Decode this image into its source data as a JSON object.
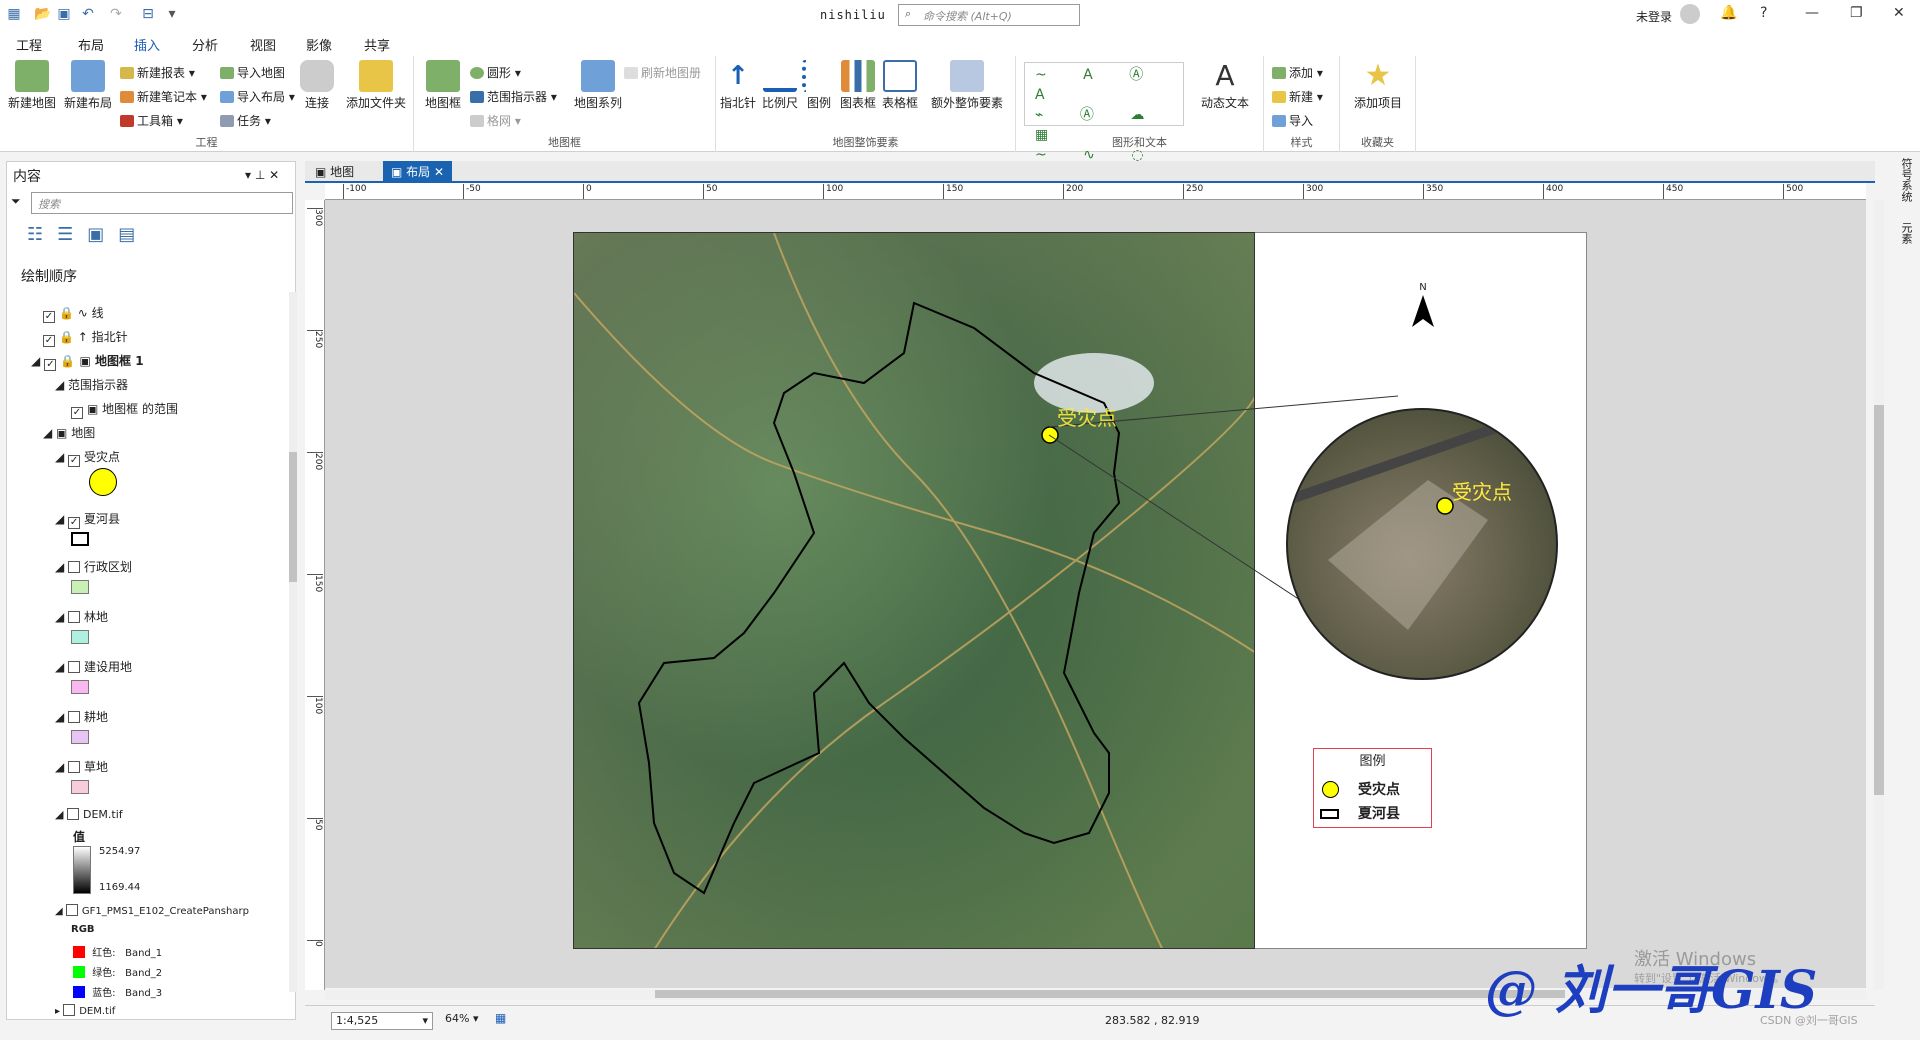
{
  "window": {
    "title": "nishiliu",
    "command_placeholder": "命令搜索 (Alt+Q)",
    "user": "未登录"
  },
  "menu": {
    "tabs": [
      "工程",
      "布局",
      "插入",
      "分析",
      "视图",
      "影像",
      "共享"
    ],
    "active": 2
  },
  "ribbon": {
    "project": {
      "label": "工程",
      "new_map": "新建地图",
      "new_layout": "新建布局",
      "new_report": "新建报表",
      "new_notebook": "新建笔记本",
      "toolbox": "工具箱",
      "import_map": "导入地图",
      "import_layout": "导入布局",
      "task": "任务",
      "connect": "连接",
      "add_folder": "添加文件夹"
    },
    "mapframe": {
      "label": "地图框",
      "map_frame": "地图框",
      "shape": "圆形",
      "extent_indicator": "范围指示器",
      "grid": "格网",
      "map_series": "地图系列",
      "refresh": "刷新地图册"
    },
    "surround": {
      "label": "地图整饰要素",
      "north": "指北针",
      "scale": "比例尺",
      "legend": "图例",
      "chart_frame": "图表框",
      "table_frame": "表格框",
      "extra": "额外整饰要素"
    },
    "graphics": {
      "label": "图形和文本",
      "dynamic_text": "动态文本"
    },
    "styles": {
      "label": "样式",
      "add": "添加",
      "new": "新建",
      "import": "导入"
    },
    "favorites": {
      "label": "收藏夹",
      "add_item": "添加项目"
    }
  },
  "contents": {
    "title": "内容",
    "search_placeholder": "搜索",
    "drawing_order": "绘制顺序",
    "items": [
      {
        "label": "线",
        "checked": true
      },
      {
        "label": "指北针",
        "checked": true
      },
      {
        "label": "地图框 1",
        "checked": true
      },
      {
        "label": "范围指示器"
      },
      {
        "label": "地图框 的范围",
        "checked": true
      },
      {
        "label": "地图"
      },
      {
        "label": "受灾点",
        "checked": true
      },
      {
        "label": "夏河县",
        "checked": true
      },
      {
        "label": "行政区划",
        "checked": false
      },
      {
        "label": "林地",
        "checked": false
      },
      {
        "label": "建设用地",
        "checked": false
      },
      {
        "label": "耕地",
        "checked": false
      },
      {
        "label": "草地",
        "checked": false
      },
      {
        "label": "DEM.tif",
        "checked": false
      },
      {
        "label": "GF1_PMS1_E102_CreatePansharp",
        "checked": false
      },
      {
        "label": "DEM.tif",
        "checked": false
      }
    ],
    "dem_value_label": "值",
    "dem_max": "5254.97",
    "dem_min": "1169.44",
    "rgb_label": "RGB",
    "rgb": [
      {
        "label": "红色:",
        "band": "Band_1"
      },
      {
        "label": "绿色:",
        "band": "Band_2"
      },
      {
        "label": "蓝色:",
        "band": "Band_3"
      }
    ]
  },
  "doc_tabs": [
    "地图",
    "布局"
  ],
  "ruler_top": [
    "-100",
    "-50",
    "0",
    "50",
    "100",
    "150",
    "200",
    "250",
    "300",
    "350",
    "400",
    "450",
    "500"
  ],
  "ruler_left": [
    "300",
    "250",
    "200",
    "150",
    "100",
    "50",
    "0"
  ],
  "layout": {
    "north_label": "N",
    "callout_label": "受灾点",
    "legend_title": "图例",
    "legend_items": [
      "受灾点",
      "夏河县"
    ]
  },
  "status": {
    "scale": "1:4,525",
    "zoom": "64%",
    "coords": "283.582 , 82.919"
  },
  "side_panels": [
    "符号系统",
    "元素"
  ],
  "watermark": {
    "text": "@ 刘一哥GIS",
    "activation": "激活 Windows",
    "activation_sub": "转到\"设置\"以激活 Windows。",
    "csdn": "CSDN @刘一哥GIS"
  },
  "colors": {
    "accent": "#1a5fb4",
    "disaster_point": "#ffff00",
    "boundary": "#000000",
    "legend_border": "#e04050"
  }
}
